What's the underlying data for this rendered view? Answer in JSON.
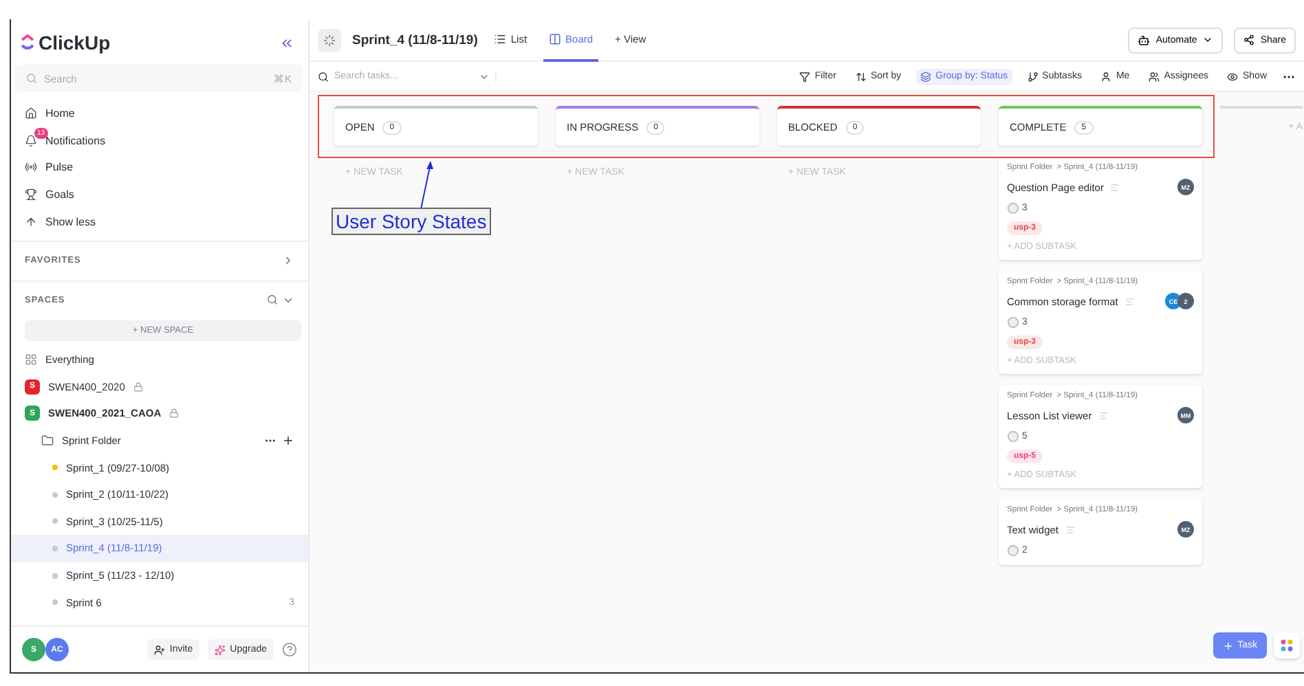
{
  "sidebar": {
    "brand": "ClickUp",
    "search": {
      "placeholder": "Search",
      "shortcut": "⌘K"
    },
    "nav": [
      {
        "label": "Home"
      },
      {
        "label": "Notifications",
        "badge": "13"
      },
      {
        "label": "Pulse"
      },
      {
        "label": "Goals"
      },
      {
        "label": "Show less"
      }
    ],
    "favorites": "FAVORITES",
    "spaces_title": "SPACES",
    "new_space": "+ NEW SPACE",
    "spaces": [
      {
        "kind": "all",
        "label": "Everything",
        "bold": false
      },
      {
        "kind": "space",
        "label": "SWEN400_2020",
        "letter": "S",
        "color": "#e5252a",
        "locked": true,
        "bold": false
      },
      {
        "kind": "space",
        "label": "SWEN400_2021_CAOA",
        "letter": "S",
        "color": "#2ea55a",
        "locked": true,
        "bold": true,
        "folder": {
          "label": "Sprint Folder",
          "lists": [
            {
              "label": "Sprint_1 (09/27-10/08)",
              "color": "#f5c000",
              "selected": false
            },
            {
              "label": "Sprint_2 (10/11-10/22)",
              "color": "#c8c8c8",
              "selected": false
            },
            {
              "label": "Sprint_3 (10/25-11/5)",
              "color": "#c8c8c8",
              "selected": false
            },
            {
              "label": "Sprint_4 (11/8-11/19)",
              "color": "#c8c8c8",
              "selected": true
            },
            {
              "label": "Sprint_5 (11/23 - 12/10)",
              "color": "#c8c8c8",
              "selected": false
            },
            {
              "label": "Sprint 6",
              "color": "#c8c8c8",
              "selected": false,
              "count": "3"
            }
          ]
        }
      }
    ],
    "footer": {
      "avatars": [
        {
          "initials": "S",
          "color": "#3aa866"
        },
        {
          "initials": "AC",
          "color": "#5a7bef"
        }
      ],
      "invite": "Invite",
      "upgrade": "Upgrade"
    }
  },
  "header": {
    "title": "Sprint_4 (11/8-11/19)",
    "views": [
      {
        "label": "List",
        "selected": false
      },
      {
        "label": "Board",
        "selected": true
      },
      {
        "label": "+ View",
        "selected": false
      }
    ],
    "automate": "Automate",
    "share": "Share"
  },
  "toolbar": {
    "search_placeholder": "Search tasks...",
    "actions": [
      {
        "label": "Filter",
        "selected": false
      },
      {
        "label": "Sort by",
        "selected": false
      },
      {
        "label": "Group by: Status",
        "selected": true
      },
      {
        "label": "Subtasks",
        "selected": false
      },
      {
        "label": "Me",
        "selected": false
      },
      {
        "label": "Assignees",
        "selected": false
      },
      {
        "label": "Show",
        "selected": false
      }
    ]
  },
  "board": {
    "columns": [
      {
        "name": "OPEN",
        "count": "0",
        "color": "#c9c9c9",
        "new_task": "+ NEW TASK"
      },
      {
        "name": "IN PROGRESS",
        "count": "0",
        "color": "#a47bf0",
        "new_task": "+ NEW TASK"
      },
      {
        "name": "BLOCKED",
        "count": "0",
        "color": "#d23434",
        "new_task": "+ NEW TASK"
      },
      {
        "name": "COMPLETE",
        "count": "5",
        "color": "#6bc950",
        "cards": [
          {
            "folder": "Sprint Folder",
            "list": "> Sprint_4 (11/8-11/19)",
            "title": "Question Page editor",
            "assignees": [
              {
                "initials": "MZ",
                "color": "#516170"
              }
            ],
            "points": "3",
            "tag": {
              "label": "usp-3",
              "color": "#e04848"
            },
            "add_subtask": "+ ADD SUBTASK"
          },
          {
            "folder": "Sprint Folder",
            "list": "> Sprint_4 (11/8-11/19)",
            "title": "Common storage format",
            "assignees": [
              {
                "initials": "CE",
                "color": "#1a8ad6"
              },
              {
                "initials": "2",
                "color": "#516170"
              }
            ],
            "points": "3",
            "tag": {
              "label": "usp-3",
              "color": "#e04848"
            },
            "add_subtask": "+ ADD SUBTASK"
          },
          {
            "folder": "Sprint Folder",
            "list": "> Sprint_4 (11/8-11/19)",
            "title": "Lesson List viewer",
            "assignees": [
              {
                "initials": "MM",
                "color": "#516170"
              }
            ],
            "points": "5",
            "tag": {
              "label": "usp-5",
              "color": "#e8407a"
            },
            "add_subtask": "+ ADD SUBTASK"
          },
          {
            "folder": "Sprint Folder",
            "list": "> Sprint_4 (11/8-11/19)",
            "title": "Text widget",
            "assignees": [
              {
                "initials": "MZ",
                "color": "#516170"
              }
            ],
            "points": "2"
          }
        ]
      }
    ],
    "add_column": "+ A"
  },
  "annotation": {
    "label": "User Story States"
  },
  "fab": {
    "label": "Task"
  }
}
